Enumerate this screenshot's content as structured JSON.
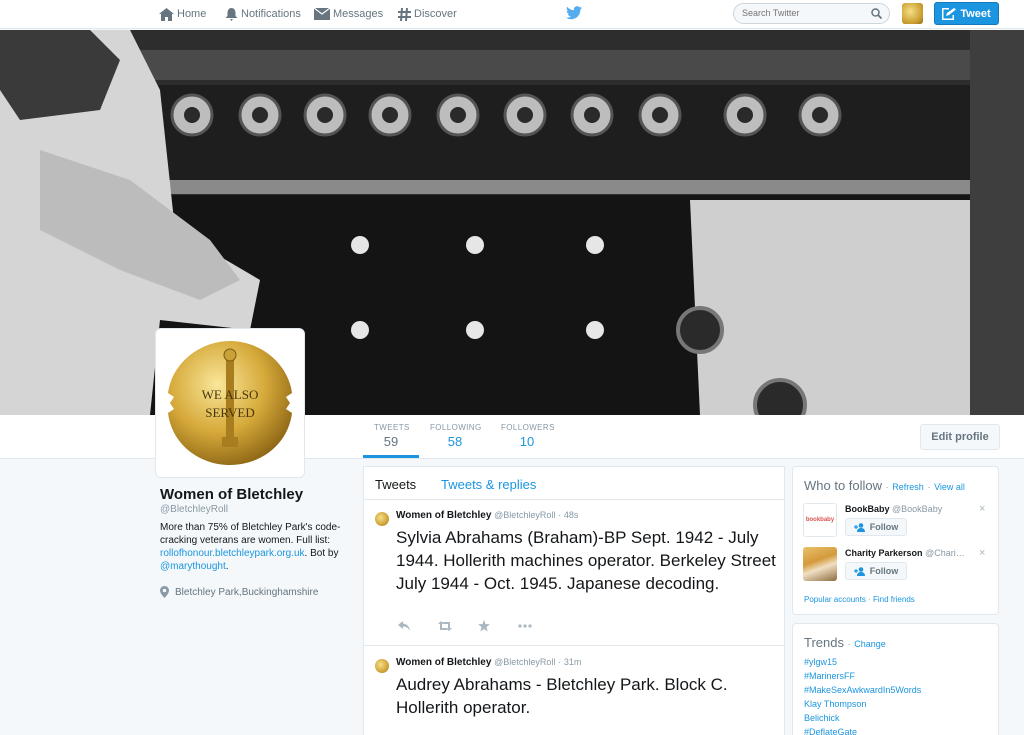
{
  "nav": {
    "home": "Home",
    "notifications": "Notifications",
    "messages": "Messages",
    "discover": "Discover",
    "search_placeholder": "Search Twitter",
    "tweet_button": "Tweet"
  },
  "profile": {
    "name": "Women of Bletchley",
    "handle": "@BletchleyRoll",
    "bio_text": "More than 75% of Bletchley Park's code-cracking veterans are women. Full list: ",
    "bio_link": "rollofhonour.bletchleypark.org.uk",
    "bio_mid": ". Bot by ",
    "bio_mention": "@marythought",
    "bio_end": ".",
    "location": "Bletchley Park,Buckinghamshire",
    "avatar_line1": "WE ALSO",
    "avatar_line2": "SERVED"
  },
  "stats": [
    {
      "label": "TWEETS",
      "value": "59"
    },
    {
      "label": "FOLLOWING",
      "value": "58"
    },
    {
      "label": "FOLLOWERS",
      "value": "10"
    }
  ],
  "edit_profile": "Edit profile",
  "timeline": {
    "tabs": [
      "Tweets",
      "Tweets & replies"
    ],
    "tweets": [
      {
        "name": "Women of Bletchley",
        "handle": "@BletchleyRoll",
        "time": "48s",
        "text": "Sylvia Abrahams (Braham)-BP Sept. 1942 - July 1944. Hollerith machines operator. Berkeley Street July 1944 - Oct. 1945. Japanese decoding."
      },
      {
        "name": "Women of Bletchley",
        "handle": "@BletchleyRoll",
        "time": "31m",
        "text": "Audrey Abrahams - Bletchley Park. Block C. Hollerith operator."
      }
    ]
  },
  "who_to_follow": {
    "title": "Who to follow",
    "refresh": "Refresh",
    "view_all": "View all",
    "users": [
      {
        "name": "BookBaby",
        "handle": "@BookBaby",
        "follow": "Follow",
        "logo": "bookbaby"
      },
      {
        "name": "Charity Parkerson",
        "handle": "@Chari…",
        "follow": "Follow"
      }
    ],
    "popular": "Popular accounts",
    "find_friends": "Find friends"
  },
  "trends": {
    "title": "Trends",
    "change": "Change",
    "items": [
      "#ylgw15",
      "#MarinersFF",
      "#MakeSexAwkwardIn5Words",
      "Klay Thompson",
      "Belichick",
      "#DeflateGate"
    ]
  },
  "colors": {
    "accent": "#1b95e0",
    "background": "#f5f8fa"
  }
}
